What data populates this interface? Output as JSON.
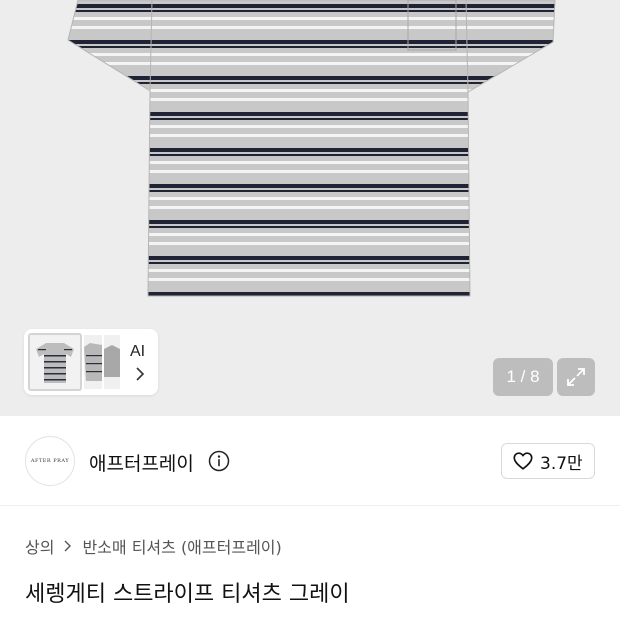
{
  "gallery": {
    "ai_label": "AI",
    "counter": "1 / 8"
  },
  "brand": {
    "logo_text": "AFTER PRAY",
    "name": "애프터프레이",
    "likes": "3.7만"
  },
  "breadcrumb": {
    "items": [
      "상의",
      "반소매 티셔츠 (애프터프레이)"
    ]
  },
  "product": {
    "title": "세렝게티 스트라이프 티셔츠 그레이"
  },
  "colors": {
    "body_grey": "#c9c9c9",
    "stripe_navy": "#1f2333",
    "stripe_white": "#f4f4f4",
    "background": "#ededed"
  }
}
